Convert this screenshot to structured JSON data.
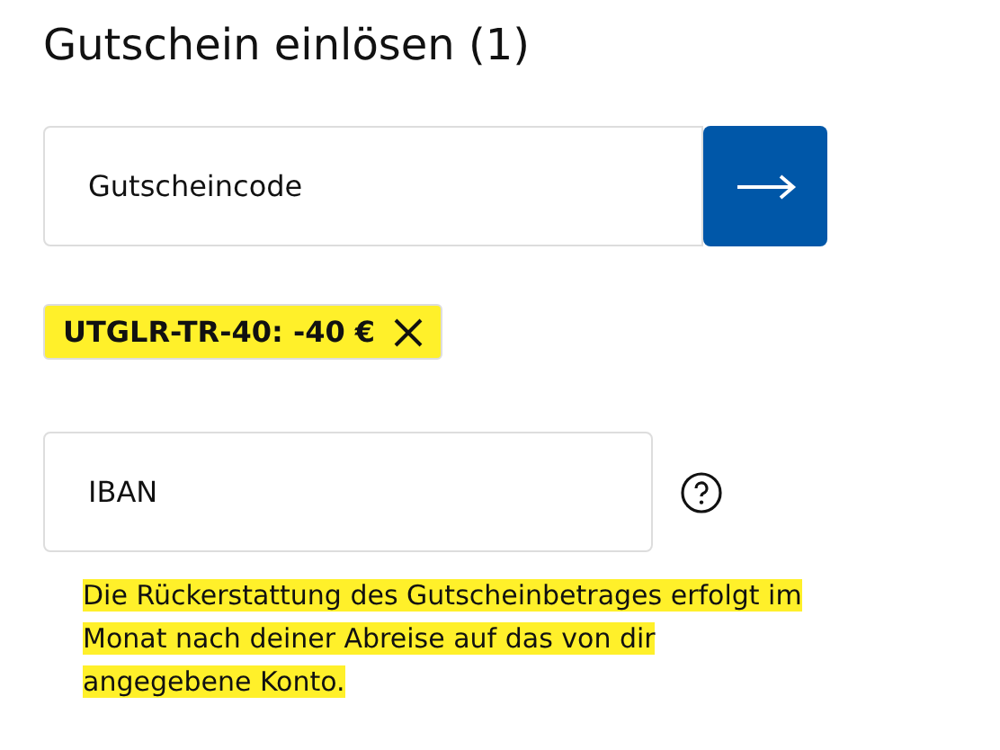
{
  "title": "Gutschein einlösen (1)",
  "voucher_field": {
    "placeholder": "Gutscheincode"
  },
  "applied_voucher": {
    "label": "UTGLR-TR-40: -40 €",
    "highlighted": true
  },
  "iban_field": {
    "placeholder": "IBAN"
  },
  "note": {
    "text": "Die Rückerstattung des Gutscheinbetrages erfolgt im Monat nach deiner Abreise auf das von dir angegebene Konto.",
    "highlighted": true
  }
}
